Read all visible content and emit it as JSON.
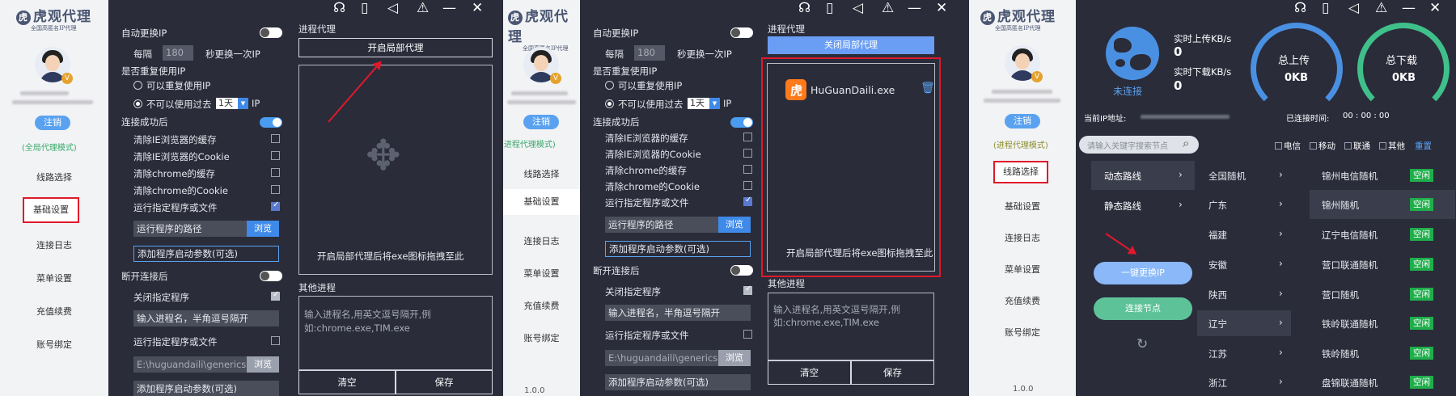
{
  "brand": {
    "title": "虎观代理",
    "subtitle": "全国高匿名IP代理"
  },
  "sidebar": {
    "logout": "注销",
    "mode": "(全局代理模式)",
    "mode_short": "(进程代理模式)",
    "items": [
      "线路选择",
      "基础设置",
      "连接日志",
      "菜单设置",
      "充值续费",
      "账号绑定"
    ],
    "version": "1.0.0"
  },
  "settings": {
    "auto_change": "自动更换IP",
    "every": "每隔",
    "every_value": "180",
    "every_suffix": "秒更换一次IP",
    "reuse_q": "是否重复使用IP",
    "reuse_yes": "可以重复使用IP",
    "reuse_no": "不可以使用过去",
    "reuse_days": "1天",
    "reuse_ip": "IP",
    "on_connect": "连接成功后",
    "clear_ie_cache": "清除IE浏览器的缓存",
    "clear_ie_cookie": "清除IE浏览器的Cookie",
    "clear_chrome_cache": "清除chrome的缓存",
    "clear_chrome_cookie": "清除chrome的Cookie",
    "run_program": "运行指定程序或文件",
    "program_path": "运行程序的路径",
    "browse": "浏览",
    "add_params": "添加程序启动参数(可选)",
    "on_disconnect": "断开连接后",
    "close_program": "关闭指定程序",
    "process_input": "输入进程名，半角逗号隔开",
    "path_value": "E:\\huguandaili\\generics"
  },
  "proxy": {
    "title": "进程代理",
    "start_btn": "开启局部代理",
    "stop_btn": "关闭局部代理",
    "drop_hint": "开启局部代理后将exe图标拖拽至此",
    "exe_name": "HuGuanDaili.exe",
    "other_title": "其他进程",
    "other_placeholder": "输入进程名,用英文逗号隔开,例如:chrome.exe,TIM.exe",
    "other_line1": "输入进程名,用英文逗号隔开,例",
    "other_line2": "如:chrome.exe,TIM.exe",
    "clear": "清空",
    "save": "保存"
  },
  "dashboard": {
    "status": "未连接",
    "upload_label": "实时上传KB/s",
    "upload_value": "0",
    "download_label": "实时下载KB/s",
    "download_value": "0",
    "total_up_label": "总上传",
    "total_up_value": "0KB",
    "total_down_label": "总下载",
    "total_down_value": "0KB",
    "ip_label": "当前IP地址:",
    "connected_label": "已连接时间:",
    "connected_time": "00 : 00 : 00",
    "search_placeholder": "请输入关键字搜索节点",
    "filters": [
      "电信",
      "移动",
      "联通",
      "其他"
    ],
    "reset": "重置",
    "route_types": [
      "动态路线",
      "静态路线"
    ],
    "change_ip": "一键更换IP",
    "connect_node": "连接节点",
    "provinces": [
      "全国随机",
      "广东",
      "福建",
      "安徽",
      "陕西",
      "辽宁",
      "江苏",
      "浙江"
    ],
    "nodes": [
      "锦州电信随机",
      "锦州随机",
      "辽宁电信随机",
      "营口联通随机",
      "营口随机",
      "铁岭联通随机",
      "铁岭随机",
      "盘锦联通随机"
    ],
    "node_status": "空闲"
  },
  "colors": {
    "dark_bg": "#2a2c3a",
    "accent_blue": "#3f8ae8",
    "highlight_red": "#e0192b",
    "idle_green": "#1fae4b"
  }
}
